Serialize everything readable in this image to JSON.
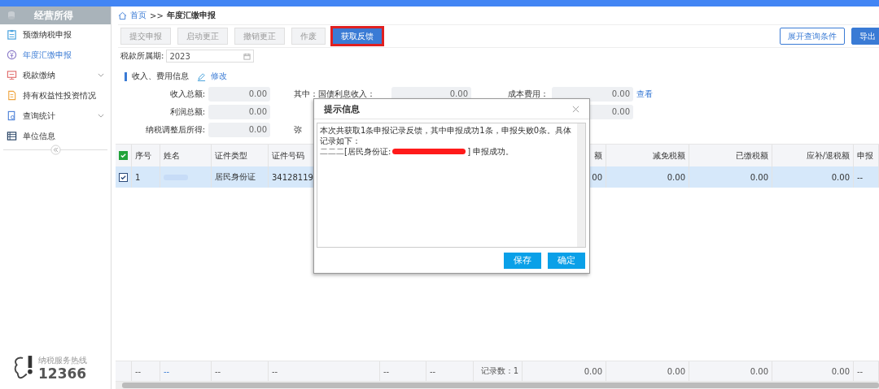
{
  "sidebar": {
    "title": "经营所得",
    "items": [
      {
        "label": "预缴纳税申报",
        "selected": false,
        "expandable": false
      },
      {
        "label": "年度汇缴申报",
        "selected": true,
        "expandable": false
      },
      {
        "label": "税款缴纳",
        "selected": false,
        "expandable": true
      },
      {
        "label": "持有权益性投资情况",
        "selected": false,
        "expandable": false
      },
      {
        "label": "查询统计",
        "selected": false,
        "expandable": true
      },
      {
        "label": "单位信息",
        "selected": false,
        "expandable": false
      }
    ],
    "hotline": {
      "caption": "纳税服务热线",
      "number": "12366"
    }
  },
  "breadcrumb": {
    "home": "首页",
    "separator": ">>",
    "current": "年度汇缴申报"
  },
  "toolbar": {
    "buttons": [
      {
        "label": "提交申报",
        "disabled": true,
        "highlighted": false
      },
      {
        "label": "启动更正",
        "disabled": true,
        "highlighted": false
      },
      {
        "label": "撤销更正",
        "disabled": true,
        "highlighted": false
      },
      {
        "label": "作废",
        "disabled": true,
        "highlighted": false
      },
      {
        "label": "获取反馈",
        "disabled": false,
        "highlighted": true
      }
    ],
    "right_buttons": [
      {
        "label": "展开查询条件",
        "kind": "outline"
      },
      {
        "label": "导出",
        "kind": "primary"
      }
    ]
  },
  "period": {
    "label": "税款所属期:",
    "value": "2023"
  },
  "section": {
    "title": "收入、费用信息",
    "edit_link": "修改"
  },
  "form_rows": [
    [
      {
        "label": "收入总额:",
        "value": "0.00"
      },
      {
        "label": "其中：国债利息收入：",
        "value": "0.00"
      },
      {
        "label": "成本费用：",
        "value": "0.00",
        "link": "查看"
      }
    ],
    [
      {
        "label": "利润总额:",
        "value": "0.00"
      },
      {},
      {
        "value": "0.00"
      }
    ],
    [
      {
        "label": "纳税调整后所得:",
        "value": "0.00"
      },
      {
        "label": "弥"
      },
      {}
    ]
  ],
  "table": {
    "header_checked": true,
    "columns": [
      {
        "kind": "check"
      },
      {
        "label": "序号"
      },
      {
        "label": "姓名"
      },
      {
        "label": "证件类型"
      },
      {
        "label": "证件号码"
      },
      {},
      {},
      {},
      {
        "label": "额"
      },
      {
        "label": "减免税额"
      },
      {
        "label": "已缴税额"
      },
      {
        "label": "应补/退税额"
      },
      {
        "label": "申报"
      }
    ],
    "rows": [
      {
        "selected": true,
        "checked": true,
        "cells": [
          {},
          {
            "text": "1"
          },
          {
            "kind": "redacted"
          },
          {
            "text": "居民身份证"
          },
          {
            "text": "34128119"
          },
          {},
          {},
          {},
          {
            "text": "00"
          },
          {
            "text": "0.00"
          },
          {
            "text": "0.00"
          },
          {
            "text": "0.00"
          },
          {
            "text": "--"
          }
        ]
      }
    ],
    "footer": [
      {
        "text": "--"
      },
      {
        "text": "--",
        "kind": "link"
      },
      {
        "text": "--"
      },
      {
        "text": "--"
      },
      {
        "text": "--"
      },
      {
        "text": "--"
      },
      {
        "text": "记录数：1"
      },
      {
        "text": "0.00"
      },
      {
        "text": "0.00"
      },
      {
        "text": "0.00"
      },
      {
        "text": "0.00"
      },
      {
        "text": "--"
      }
    ]
  },
  "dialog": {
    "title": "提示信息",
    "lines": [
      [
        {
          "text": "本次共获取1条申报记录反馈，其中申报成功1条，申报失败0条。具体记录如下："
        }
      ],
      [
        {
          "text": "二二二[居民身份证:"
        },
        {
          "kind": "redacted"
        },
        {
          "text": "] 申报成功。"
        }
      ]
    ],
    "buttons": [
      "保存",
      "确定"
    ]
  }
}
